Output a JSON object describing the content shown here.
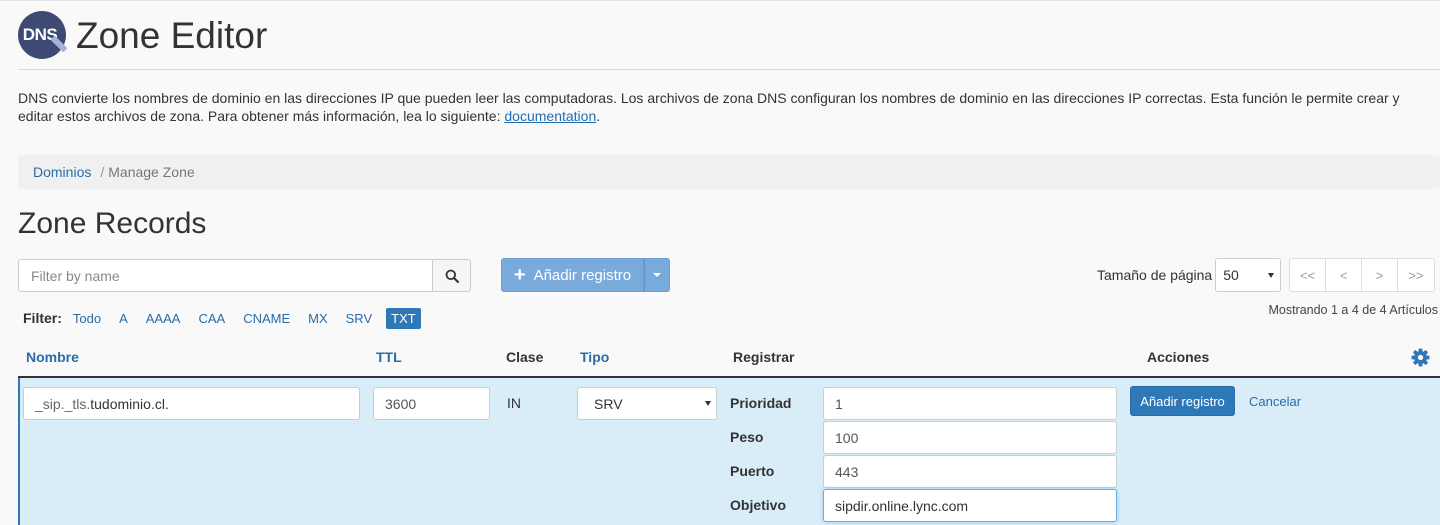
{
  "header": {
    "logo_text": "DNS",
    "title": "Zone Editor"
  },
  "description": {
    "text": "DNS convierte los nombres de dominio en las direcciones IP que pueden leer las computadoras. Los archivos de zona DNS configuran los nombres de dominio en las direcciones IP correctas. Esta función le permite crear y editar estos archivos de zona. Para obtener más información, lea lo siguiente: ",
    "link": "documentation",
    "end": "."
  },
  "breadcrumb": {
    "root": "Dominios",
    "separator": "/",
    "current": "Manage Zone"
  },
  "section_title": "Zone Records",
  "search": {
    "placeholder": "Filter by name",
    "value": ""
  },
  "add_button": {
    "label": "Añadir registro"
  },
  "page_size": {
    "label": "Tamaño de página",
    "value": "50"
  },
  "pager": {
    "first": "<<",
    "prev": "<",
    "next": ">",
    "last": ">>"
  },
  "filter": {
    "label": "Filter:",
    "items": [
      "Todo",
      "A",
      "AAAA",
      "CAA",
      "CNAME",
      "MX",
      "SRV",
      "TXT"
    ],
    "active": "TXT"
  },
  "showing": "Mostrando 1 a 4 de 4 Artículos",
  "table": {
    "headers": {
      "name": "Nombre",
      "ttl": "TTL",
      "class": "Clase",
      "type": "Tipo",
      "record": "Registrar",
      "actions": "Acciones"
    }
  },
  "edit_row": {
    "name_prefix": "_sip._tls.",
    "name_domain": "tudominio.cl.",
    "ttl": "3600",
    "class": "IN",
    "type": "SRV",
    "fields": [
      {
        "label": "Prioridad",
        "value": "1"
      },
      {
        "label": "Peso",
        "value": "100"
      },
      {
        "label": "Puerto",
        "value": "443"
      },
      {
        "label": "Objetivo",
        "value": "sipdir.online.lync.com"
      }
    ],
    "save_label": "Añadir registro",
    "cancel_label": "Cancelar"
  },
  "colors": {
    "accent": "#2f78b8",
    "edit_row_bg": "#d9edf8",
    "add_button_bg": "#78aadc"
  }
}
